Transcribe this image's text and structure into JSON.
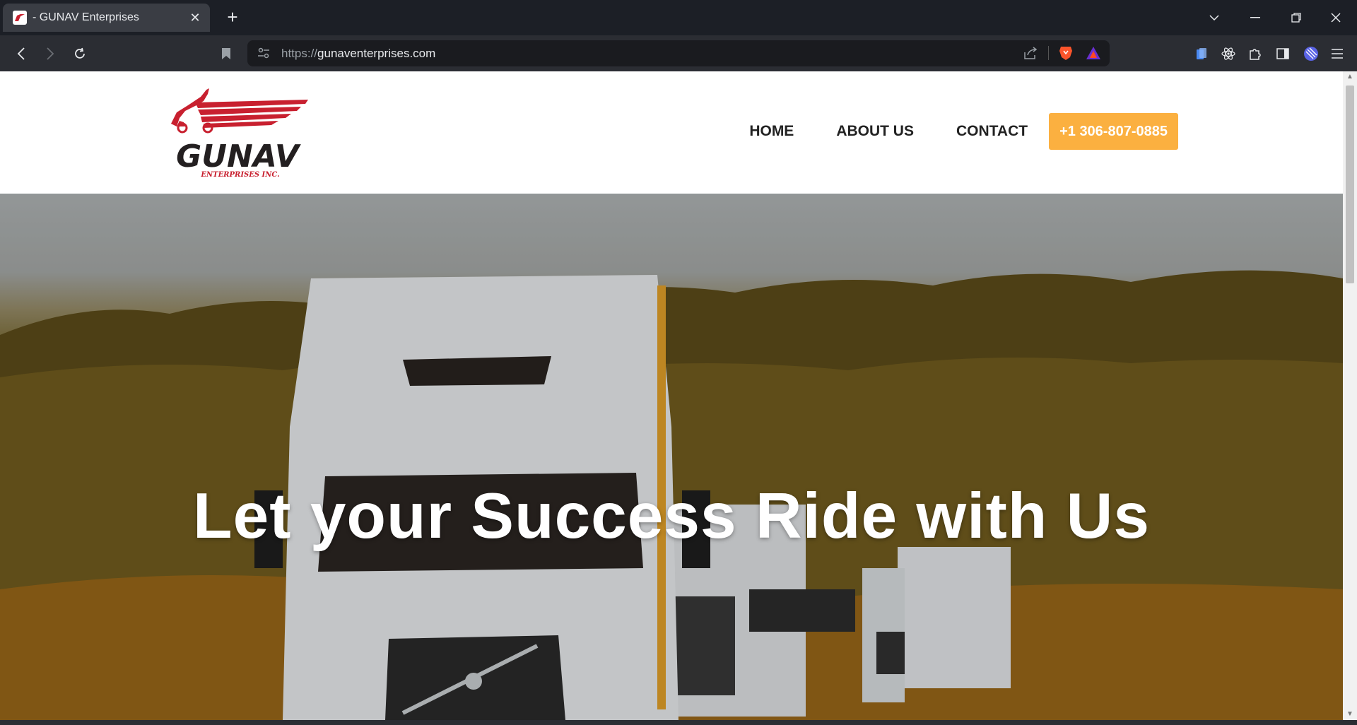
{
  "browser": {
    "tab_title": "- GUNAV Enterprises",
    "new_tab_glyph": "+",
    "close_glyph": "✕",
    "url_scheme": "https://",
    "url_host": "gunaventerprises.com"
  },
  "site": {
    "logo": {
      "name": "GUNAV",
      "tagline": "ENTERPRISES INC.",
      "color": "#c8202f"
    },
    "nav": {
      "home": "HOME",
      "about": "ABOUT US",
      "contact": "CONTACT",
      "phone": "+1 306-807-0885"
    },
    "accent_color": "#fbb040",
    "hero": {
      "headline": "Let your Success Ride with Us"
    }
  }
}
